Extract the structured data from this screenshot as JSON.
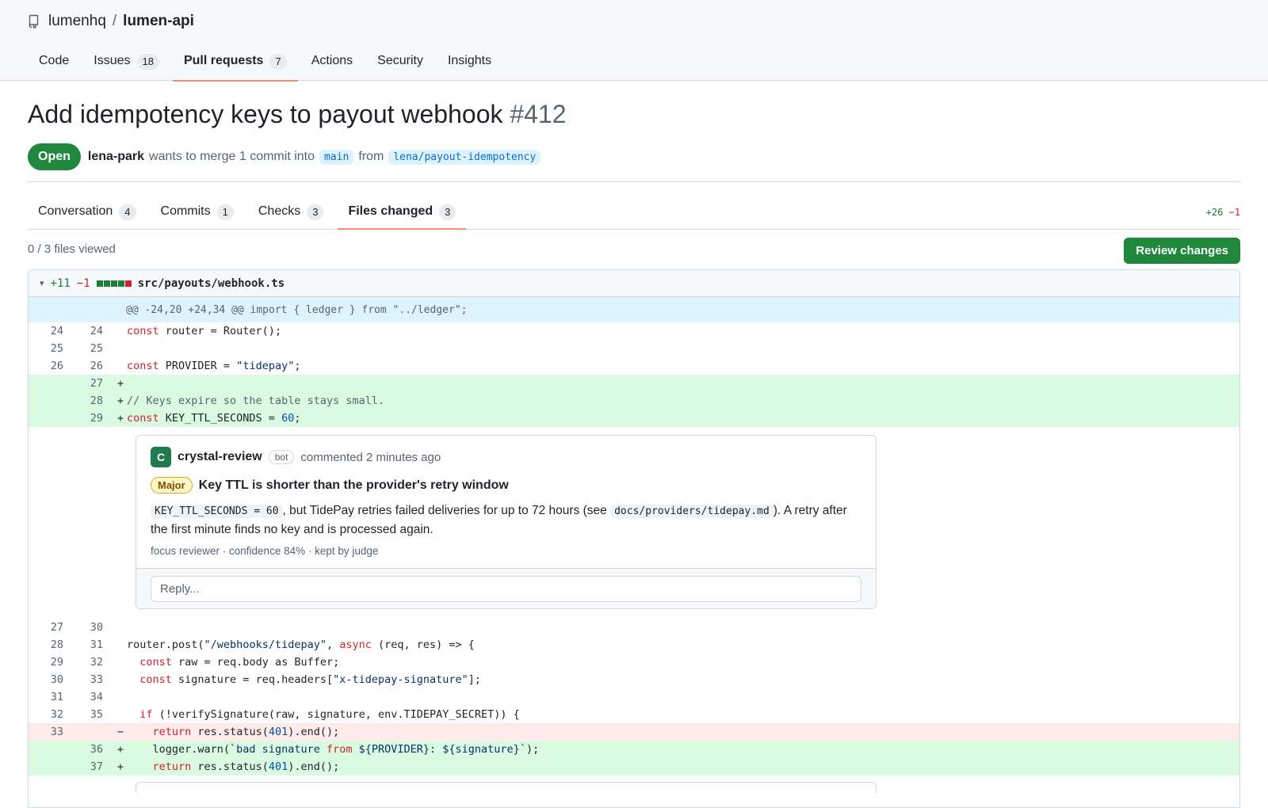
{
  "repo": {
    "owner": "lumenhq",
    "separator": "/",
    "name": "lumen-api"
  },
  "repo_nav": [
    {
      "label": "Code",
      "count": null,
      "active": false
    },
    {
      "label": "Issues",
      "count": "18",
      "active": false
    },
    {
      "label": "Pull requests",
      "count": "7",
      "active": true
    },
    {
      "label": "Actions",
      "count": null,
      "active": false
    },
    {
      "label": "Security",
      "count": null,
      "active": false
    },
    {
      "label": "Insights",
      "count": null,
      "active": false
    }
  ],
  "pr": {
    "title": "Add idempotency keys to payout webhook",
    "number": "#412",
    "state": "Open",
    "author": "lena-park",
    "merge_text": "wants to merge 1 commit into",
    "base_branch": "main",
    "from_text": "from",
    "head_branch": "lena/payout-idempotency"
  },
  "pr_tabs": [
    {
      "label": "Conversation",
      "count": "4"
    },
    {
      "label": "Commits",
      "count": "1"
    },
    {
      "label": "Checks",
      "count": "3"
    },
    {
      "label": "Files changed",
      "count": "3"
    }
  ],
  "diffstat_total": {
    "additions": "+26",
    "deletions": "−1"
  },
  "files_viewed": "0 / 3 files viewed",
  "review_button": "Review changes",
  "file": {
    "chevron": "▾",
    "additions": "+11",
    "deletions": "−1",
    "blocks": [
      "#1a7f37",
      "#1a7f37",
      "#1a7f37",
      "#1a7f37",
      "#cf222e"
    ],
    "path": "src/payouts/webhook.ts",
    "hunk": "@@ -24,20 +24,34 @@ import { ledger } from \"../ledger\";"
  },
  "comment": {
    "avatar_letter": "C",
    "author": "crystal-review",
    "badge": "bot",
    "time": "commented 2 minutes ago",
    "severity": "Major",
    "title": "Key TTL is shorter than the provider's retry window",
    "code1": "KEY_TTL_SECONDS = 60",
    "text1": ", but TidePay retries failed deliveries for up to 72 hours (see ",
    "code2": "docs/providers/tidepay.md",
    "text2": "). A retry after the first minute finds no key and is processed again.",
    "footer": "focus reviewer · confidence 84% · kept by judge",
    "reply_placeholder": "Reply..."
  },
  "colors": {
    "accent_green": "#1f883d",
    "tab_underline": "#fd8c73",
    "added_bg": "#dafbe1",
    "removed_bg": "#ffebe9",
    "hunk_bg": "#ddf4ff"
  }
}
